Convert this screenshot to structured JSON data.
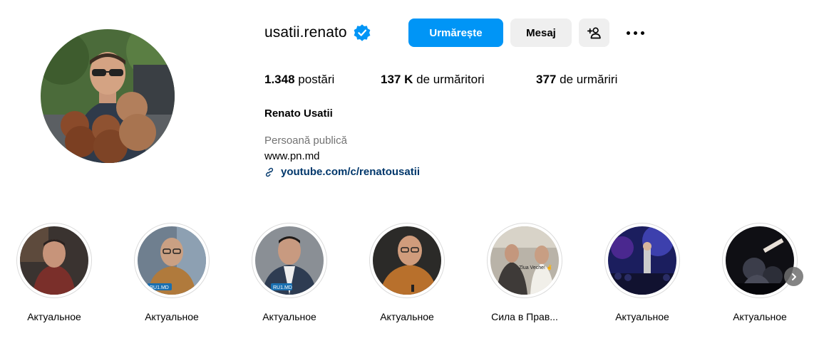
{
  "profile": {
    "username": "usatii.renato",
    "verified": true,
    "full_name": "Renato Usatii",
    "category": "Persoană publică",
    "bio": "www.pn.md",
    "link": "youtube.com/c/renatousatii"
  },
  "actions": {
    "follow_label": "Urmărește",
    "message_label": "Mesaj",
    "add_user_icon": "add-user-icon",
    "more_icon": "more-horizontal-icon"
  },
  "stats": {
    "posts_count": "1.348",
    "posts_label": "postări",
    "followers_count": "137 K",
    "followers_label": "de urmăritori",
    "following_count": "377",
    "following_label": "de urmăriri"
  },
  "highlights": [
    {
      "label": "Актуальное",
      "badge": ""
    },
    {
      "label": "Актуальное",
      "badge": "RU1.MD"
    },
    {
      "label": "Актуальное",
      "badge": "RU1.MD"
    },
    {
      "label": "Актуальное",
      "badge": ""
    },
    {
      "label": "Сила в Прав...",
      "badge": ""
    },
    {
      "label": "Актуальное",
      "badge": ""
    },
    {
      "label": "Актуальное",
      "badge": ""
    }
  ],
  "colors": {
    "primary_button": "#0095f6",
    "secondary_button": "#efefef",
    "verified_badge": "#0095f6",
    "link": "#00376b",
    "muted_text": "#737373"
  }
}
